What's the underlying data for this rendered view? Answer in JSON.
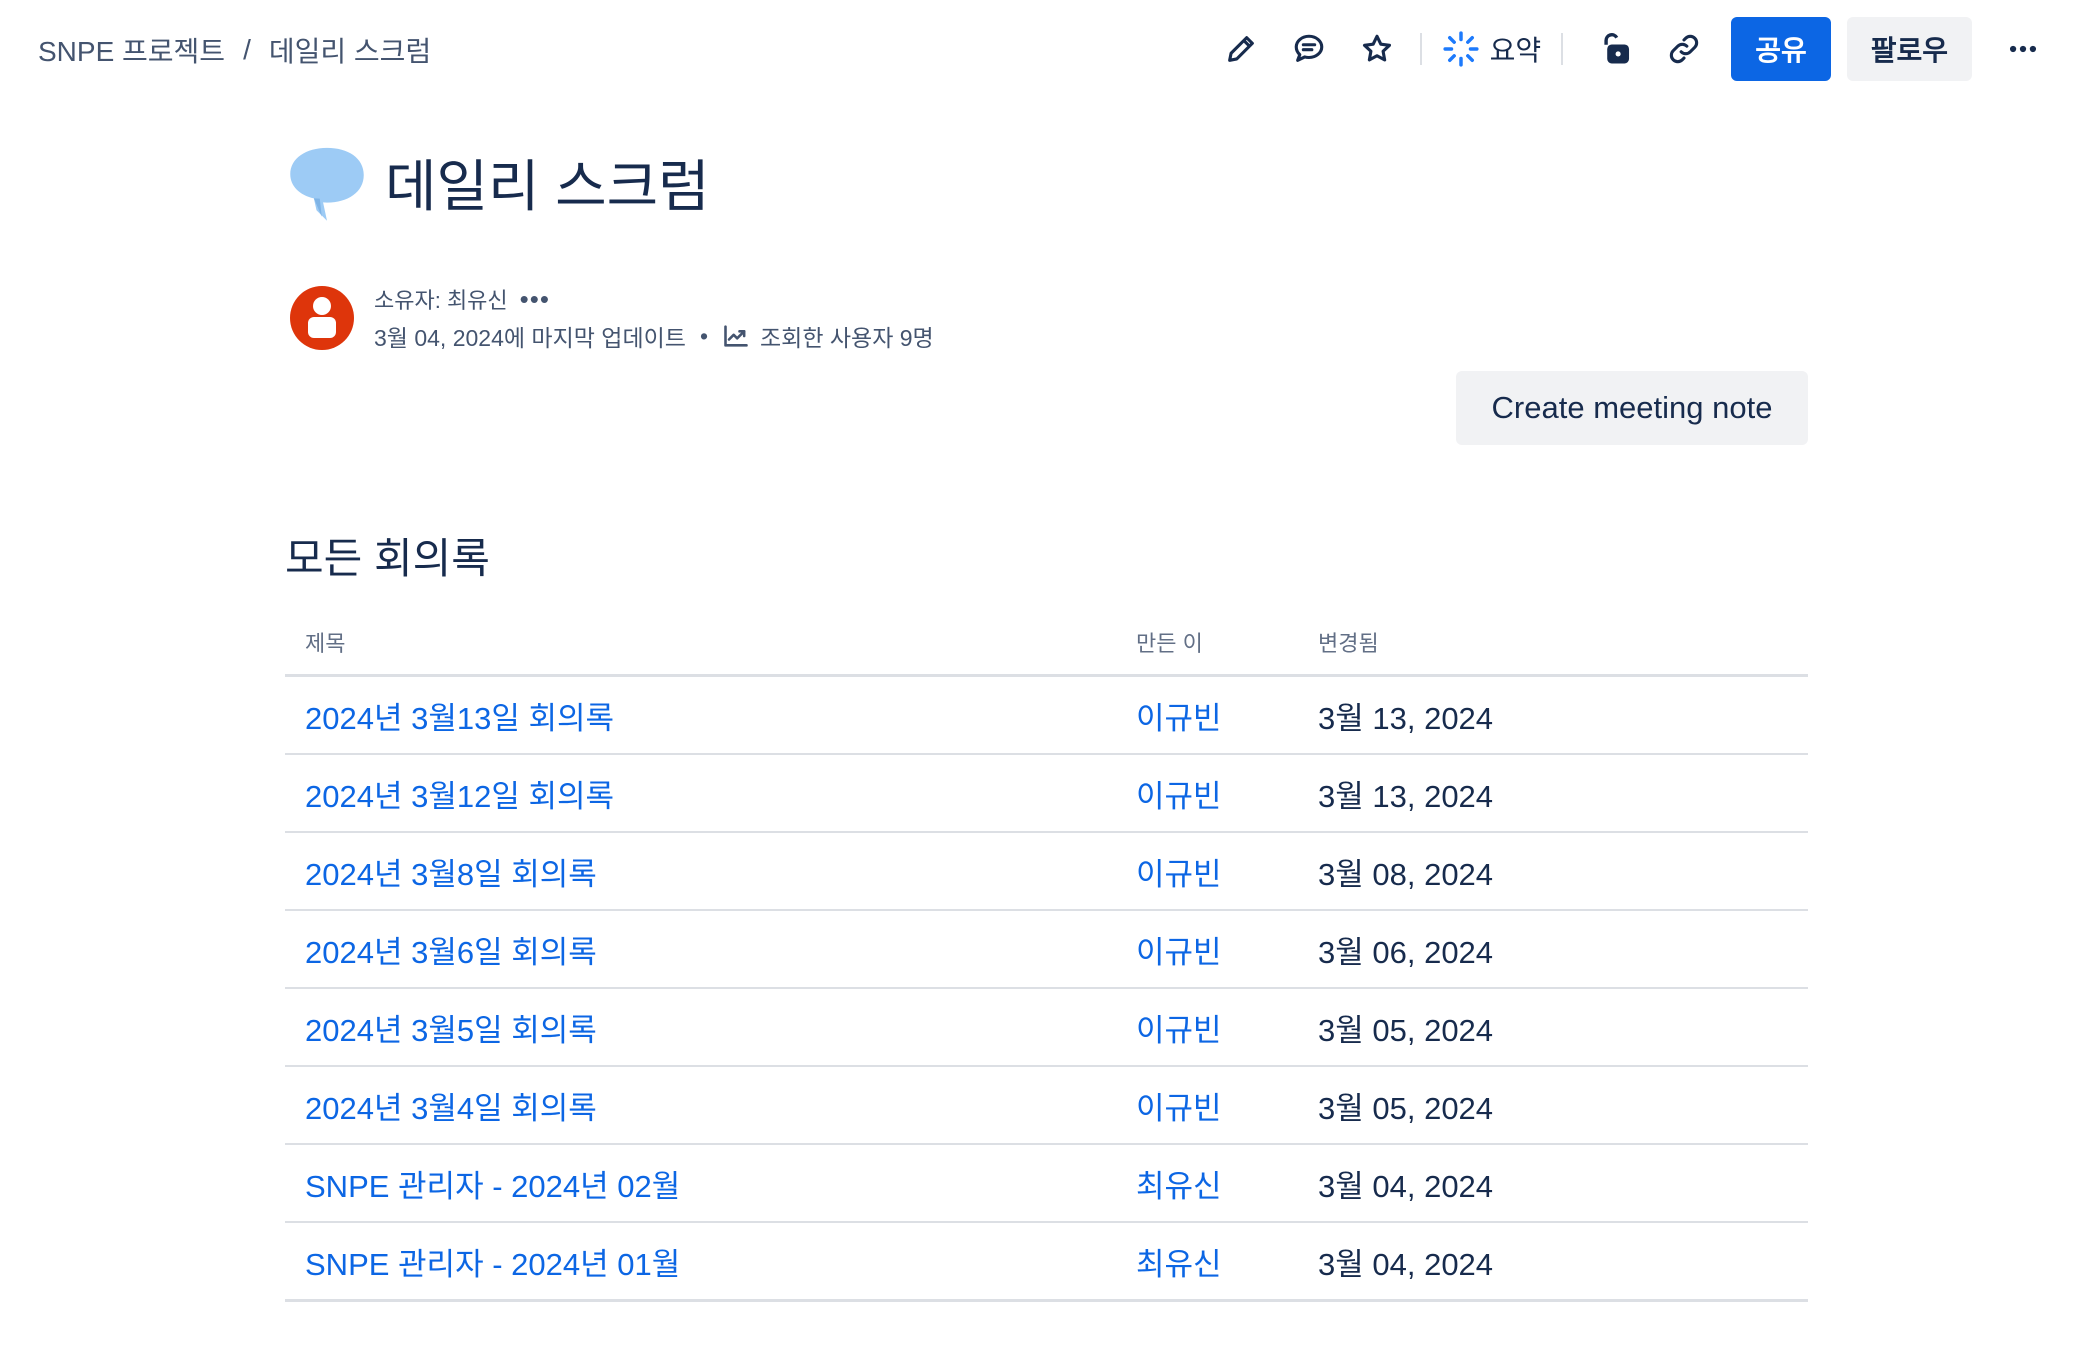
{
  "breadcrumb": {
    "space": "SNPE 프로젝트",
    "separator": "/",
    "page": "데일리 스크럼"
  },
  "toolbar": {
    "summary_label": "요약",
    "share_label": "공유",
    "follow_label": "팔로우",
    "icons": [
      "edit-icon",
      "comment-icon",
      "star-icon",
      "ai-summary-icon",
      "unlock-icon",
      "link-icon",
      "more-icon"
    ]
  },
  "page": {
    "title": "데일리 스크럼",
    "emoji": "speech-balloon-icon"
  },
  "byline": {
    "owner": "소유자: 최유신",
    "updated": "3월 04, 2024에 마지막 업데이트",
    "bullet": "•",
    "viewers": "조회한 사용자 9명"
  },
  "create_button": "Create meeting note",
  "section": {
    "title": "모든 회의록",
    "columns": [
      "제목",
      "만든 이",
      "변경됨"
    ],
    "rows": [
      {
        "title": "2024년 3월13일 회의록",
        "author": "이규빈",
        "changed": "3월 13, 2024"
      },
      {
        "title": "2024년 3월12일 회의록",
        "author": "이규빈",
        "changed": "3월 13, 2024"
      },
      {
        "title": "2024년 3월8일 회의록",
        "author": "이규빈",
        "changed": "3월 08, 2024"
      },
      {
        "title": "2024년 3월6일 회의록",
        "author": "이규빈",
        "changed": "3월 06, 2024"
      },
      {
        "title": "2024년 3월5일 회의록",
        "author": "이규빈",
        "changed": "3월 05, 2024"
      },
      {
        "title": "2024년 3월4일 회의록",
        "author": "이규빈",
        "changed": "3월 05, 2024"
      },
      {
        "title": "SNPE 관리자 - 2024년 02월",
        "author": "최유신",
        "changed": "3월 04, 2024"
      },
      {
        "title": "SNPE 관리자 - 2024년 01월",
        "author": "최유신",
        "changed": "3월 04, 2024"
      }
    ]
  },
  "colors": {
    "primary": "#0C66E4",
    "text": "#172B4D",
    "subtle": "#44546F",
    "avatar": "#DE350B",
    "emoji": "#9DCBF5"
  }
}
